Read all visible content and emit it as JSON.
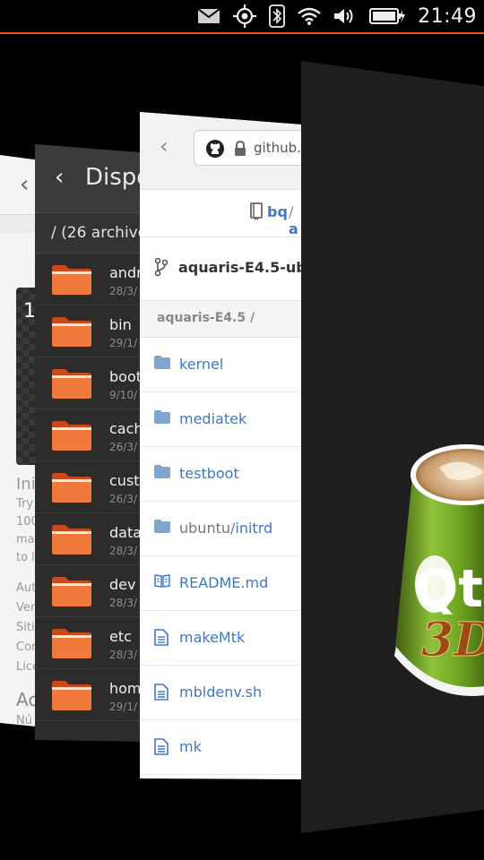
{
  "status_bar": {
    "time": "21:49",
    "icons": [
      "mail-icon",
      "location-icon",
      "bluetooth-icon",
      "wifi-icon",
      "volume-icon",
      "battery-charging-icon"
    ]
  },
  "card1": {
    "thumb_label": "1",
    "lines": [
      "Ini",
      "Try",
      "100",
      "ma",
      "to l",
      "Aut",
      "Ver",
      "Siti",
      "Cor",
      "Lice",
      "Ac",
      "Nú"
    ]
  },
  "file_manager": {
    "title": "Dispo",
    "path_summary": "/ (26 archivo",
    "items": [
      {
        "name": "andr",
        "date": "28/3/"
      },
      {
        "name": "bin",
        "date": "29/1/"
      },
      {
        "name": "boot",
        "date": "9/10/"
      },
      {
        "name": "cach",
        "date": "26/3/"
      },
      {
        "name": "custo",
        "date": "26/3/"
      },
      {
        "name": "data",
        "date": "28/3/"
      },
      {
        "name": "dev",
        "date": "28/3/"
      },
      {
        "name": "etc",
        "date": "28/3/"
      },
      {
        "name": "hom",
        "date": "29/1/"
      }
    ]
  },
  "browser": {
    "url": "github.c",
    "owner": "bq",
    "separator": "/",
    "repo_fragment": "a",
    "branch": "aquaris-E4.5-ubun",
    "path": "aquaris-E4.5 /",
    "files": [
      {
        "type": "folder",
        "name": "kernel"
      },
      {
        "type": "folder",
        "name": "mediatek"
      },
      {
        "type": "folder",
        "name": "testboot"
      },
      {
        "type": "folder",
        "prefix": "ubuntu/",
        "name": "initrd"
      },
      {
        "type": "book",
        "name": "README.md"
      },
      {
        "type": "file",
        "name": "makeMtk"
      },
      {
        "type": "file",
        "name": "mbldenv.sh"
      },
      {
        "type": "file",
        "name": "mk"
      }
    ]
  },
  "qt_app": {
    "logo_text": "Qt",
    "label_3d": "3D"
  },
  "colors": {
    "accent": "#e95420",
    "link": "#4078c0",
    "folder_orange": "#e8602c"
  }
}
